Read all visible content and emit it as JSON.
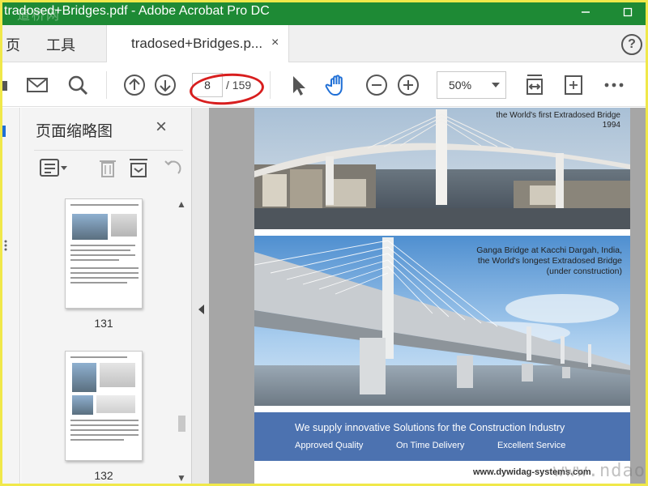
{
  "window": {
    "title": "tradosed+Bridges.pdf - Adobe Acrobat Pro DC",
    "watermark_top": "道桥网",
    "watermark_bottom": "www.ndao.co"
  },
  "tabs": {
    "home_partial": "页",
    "tools": "工具",
    "document": "tradosed+Bridges.p...",
    "close": "×",
    "help": "?"
  },
  "toolbar": {
    "current_page": "8",
    "total_pages": "/ 159",
    "zoom": "50%"
  },
  "thumbnails_panel": {
    "title": "页面缩略图",
    "close": "×",
    "items": [
      {
        "label": "131"
      },
      {
        "label": "132"
      }
    ]
  },
  "document": {
    "caption1_line1": "the World's first Extradosed Bridge",
    "caption1_line2": "1994",
    "caption2_line1": "Ganga Bridge at Kacchi Dargah, India,",
    "caption2_line2": "the World's longest Extradosed Bridge",
    "caption2_line3": "(under construction)",
    "banner_headline": "We supply innovative Solutions for the Construction Industry",
    "banner_tags": [
      "Approved Quality",
      "On Time Delivery",
      "Excellent Service"
    ],
    "website": "www.dywidag-systems.com"
  },
  "colors": {
    "titlebar": "#1e8a35",
    "banner": "#4c72b0",
    "annotation": "#d81e1e",
    "icon_blue": "#1f6fd6"
  }
}
